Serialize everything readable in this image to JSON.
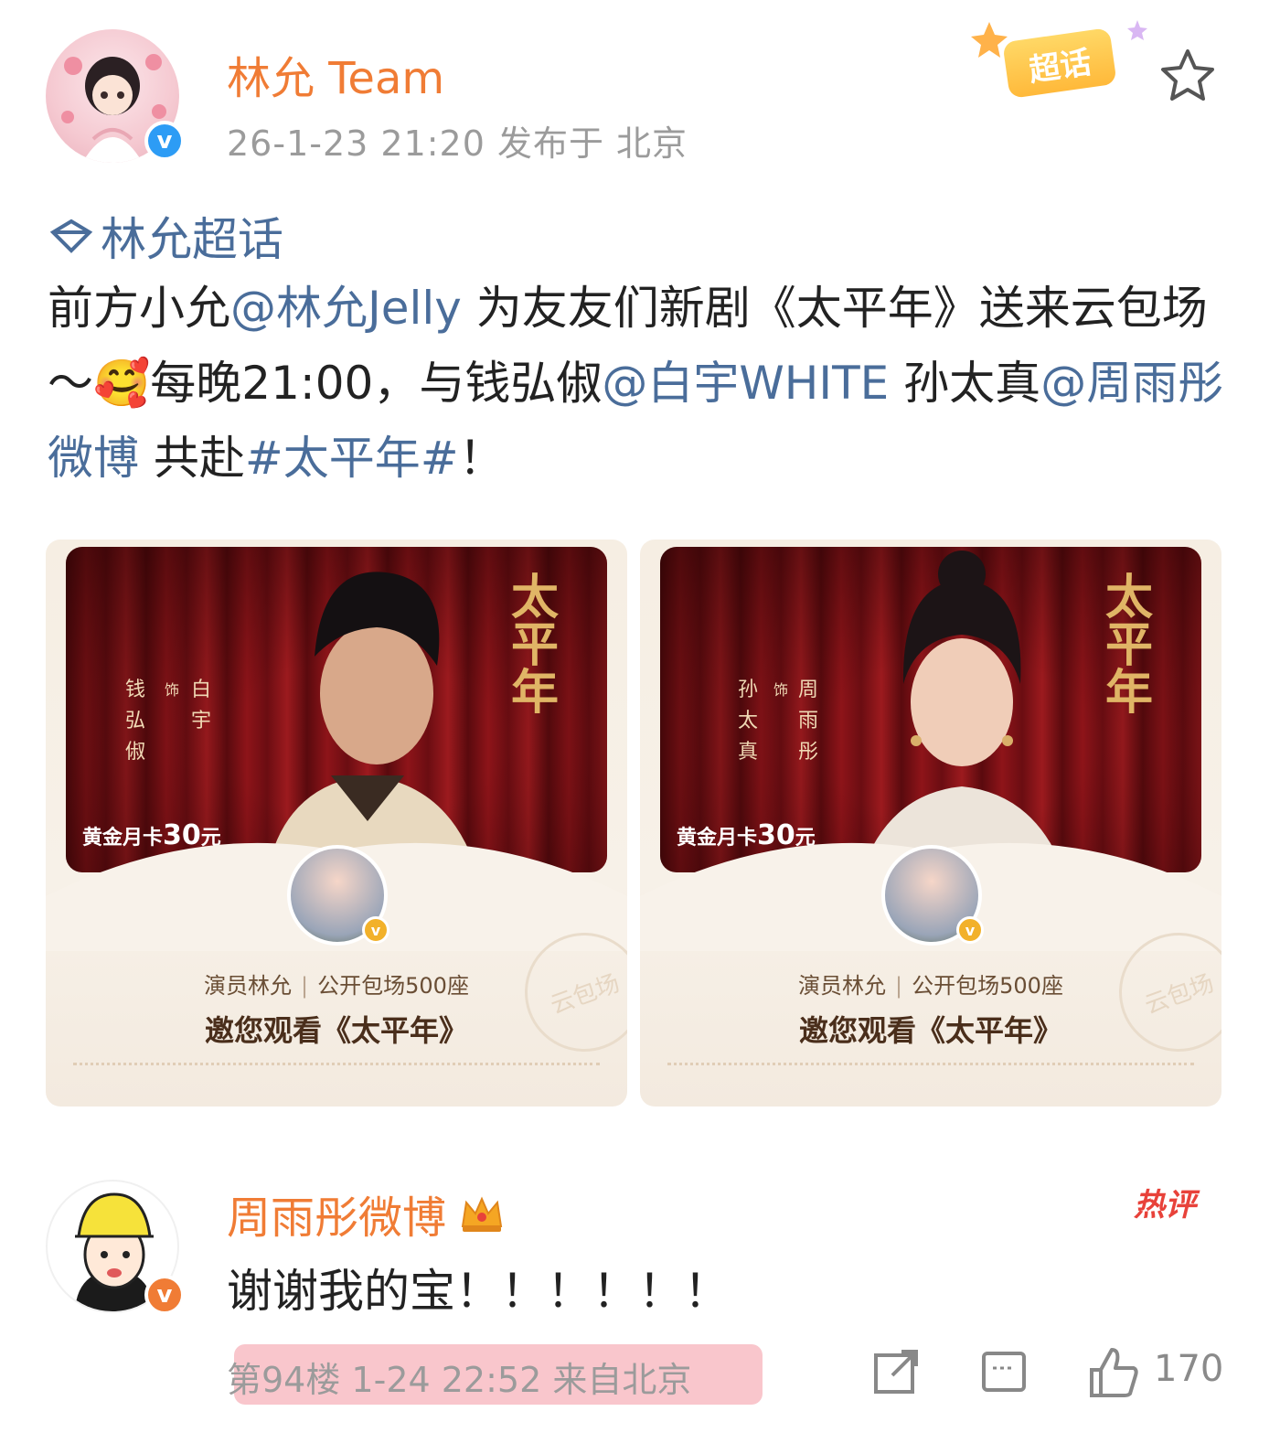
{
  "post": {
    "username": "林允 Team",
    "meta": "26-1-23 21:20  发布于 北京",
    "chaohua_label": "超话",
    "topic": "林允超话",
    "body": [
      {
        "t": "text",
        "v": "前方小允"
      },
      {
        "t": "mention",
        "v": "@林允Jelly"
      },
      {
        "t": "text",
        "v": " 为友友们新剧《太平年》送来云包场～"
      },
      {
        "t": "emoji",
        "v": "🥰"
      },
      {
        "t": "text",
        "v": "每晚21:00，与钱弘俶"
      },
      {
        "t": "mention",
        "v": "@白宇WHITE"
      },
      {
        "t": "text",
        "v": " 孙太真"
      },
      {
        "t": "mention",
        "v": "@周雨彤微博"
      },
      {
        "t": "text",
        "v": " 共赴"
      },
      {
        "t": "mention",
        "v": "#太平年#"
      },
      {
        "t": "text",
        "v": "！"
      }
    ]
  },
  "cards": [
    {
      "poster_title": "太平年",
      "role_left": "钱弘俶",
      "role_mid": "饰",
      "role_right": "白宇",
      "price_prefix": "黄金月卡",
      "price_value": "30",
      "price_unit": "元",
      "sub_left": "演员林允",
      "sub_right": "公开包场500座",
      "title": "邀您观看《太平年》",
      "stamp": "云包场"
    },
    {
      "poster_title": "太平年",
      "role_left": "孙太真",
      "role_mid": "饰",
      "role_right": "周雨彤",
      "price_prefix": "黄金月卡",
      "price_value": "30",
      "price_unit": "元",
      "sub_left": "演员林允",
      "sub_right": "公开包场500座",
      "title": "邀您观看《太平年》",
      "stamp": "云包场"
    }
  ],
  "comment": {
    "username": "周雨彤微博",
    "hot_label": "热评",
    "text": "谢谢我的宝！！！！！！",
    "meta": "第94楼 1-24 22:52 来自北京",
    "like_count": "170"
  },
  "colors": {
    "accent": "#f07c35",
    "link": "#4a6d9a",
    "verified_blue": "#2d9cf5",
    "hot_red": "#e8423a",
    "highlight": "#f9c6cc"
  },
  "icons": {
    "verified": "v",
    "comment_verified": "v"
  }
}
